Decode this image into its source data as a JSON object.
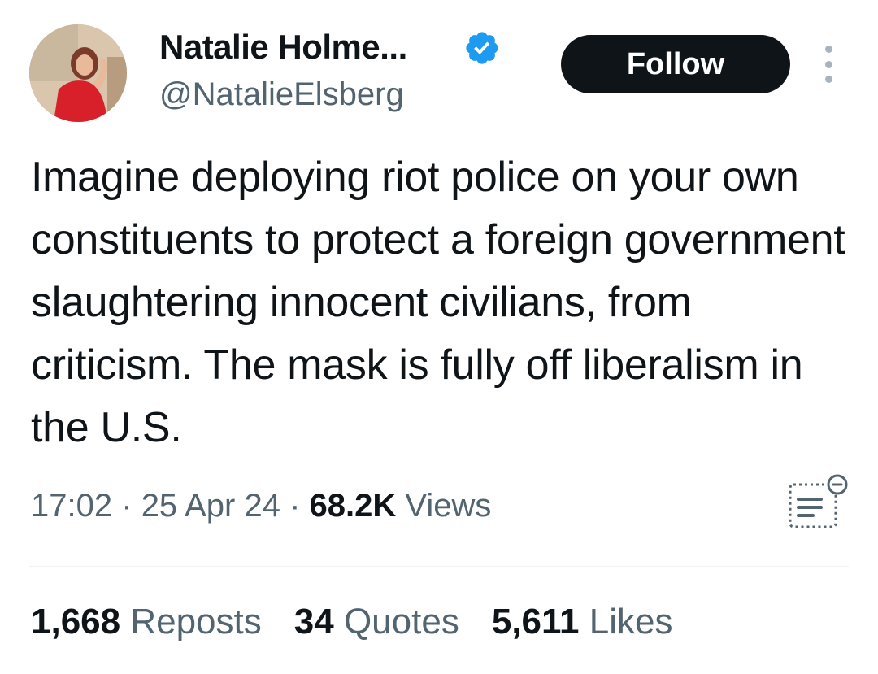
{
  "author": {
    "display_name": "Natalie Holme...",
    "handle": "@NatalieElsberg",
    "verified": true,
    "avatar_icon": "profile-photo"
  },
  "actions": {
    "follow_label": "Follow",
    "more_icon": "more-vertical-icon"
  },
  "tweet": {
    "text": "Imagine deploying riot police on your own constituents to protect a foreign government slaughtering innocent civilians, from criticism.  The mask is fully off liberalism in the U.S.",
    "time": "17:02",
    "separator": "·",
    "date": "25 Apr 24",
    "views_count": "68.2K",
    "views_label": "Views",
    "summary_icon": "grok-summary-icon"
  },
  "stats": {
    "reposts": {
      "count": "1,668",
      "label": "Reposts"
    },
    "quotes": {
      "count": "34",
      "label": "Quotes"
    },
    "likes": {
      "count": "5,611",
      "label": "Likes"
    }
  },
  "colors": {
    "text": "#0f1419",
    "secondary": "#536471",
    "verified": "#1d9bf0",
    "button_bg": "#0f1419",
    "divider": "#eff3f4"
  }
}
